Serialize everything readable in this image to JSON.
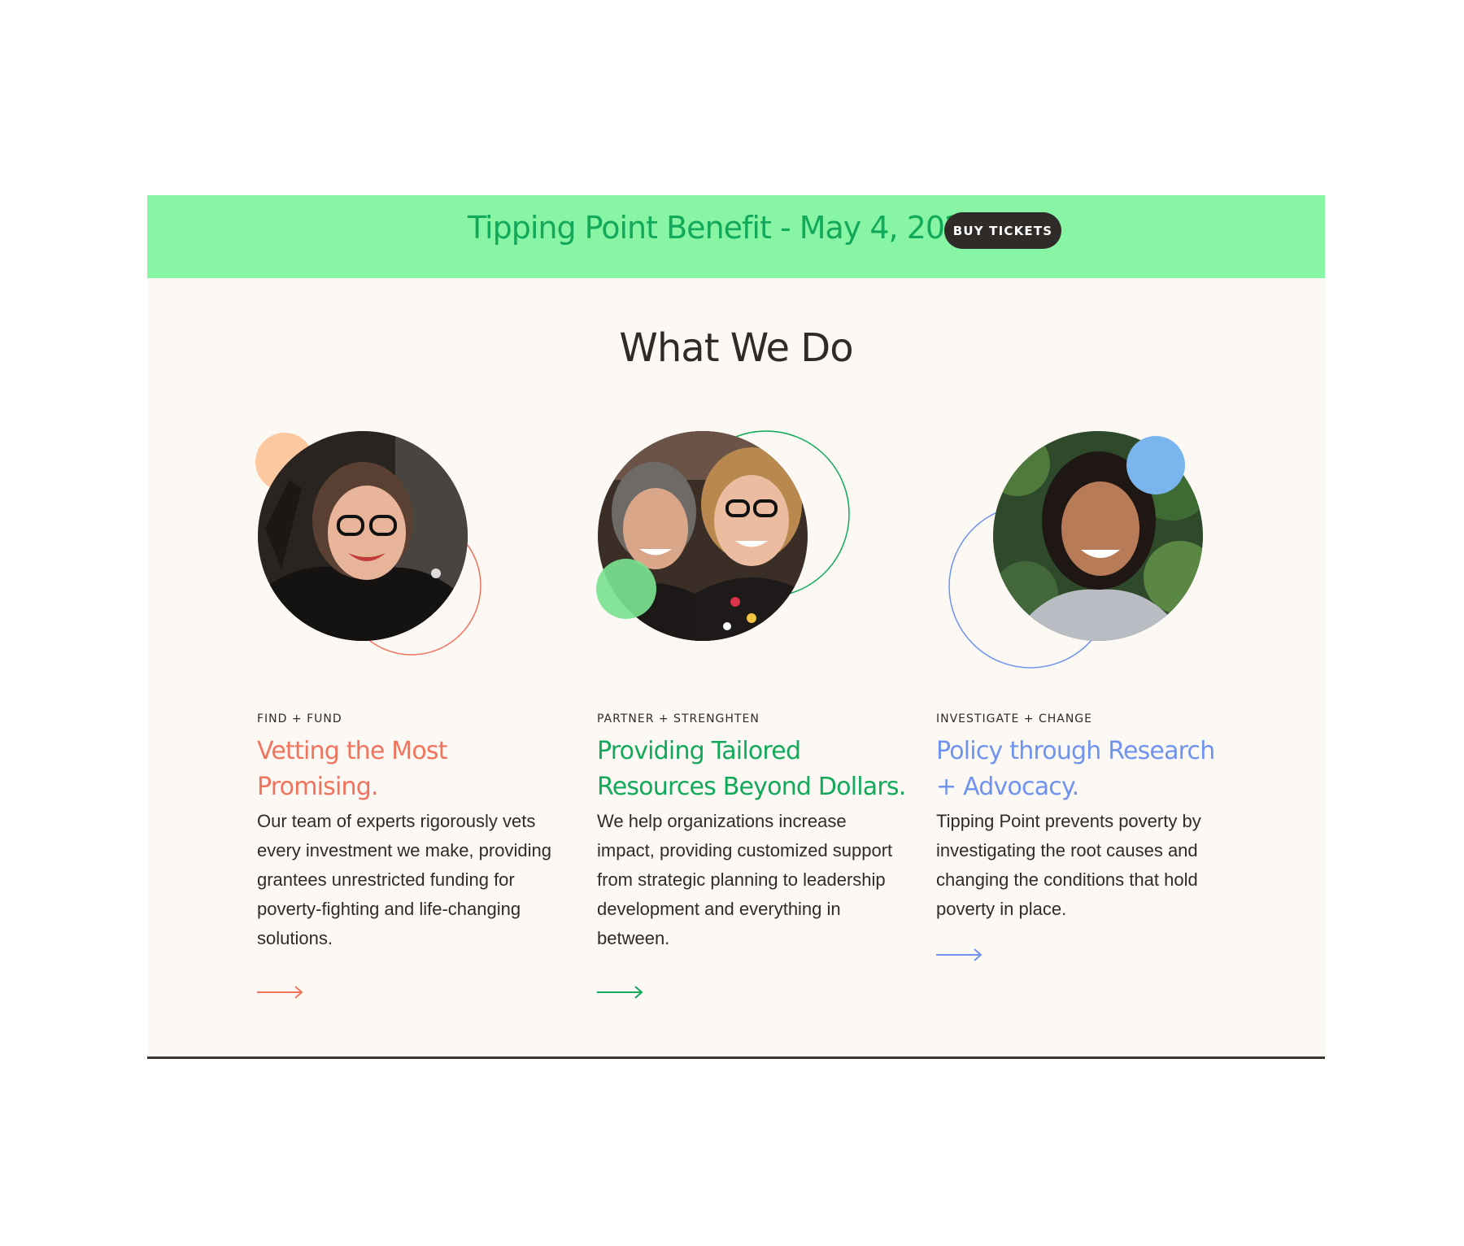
{
  "banner": {
    "text": "Tipping Point Benefit - May 4, 2023.",
    "button_label": "BUY TICKETS",
    "colors": {
      "background": "#88f5a5",
      "text": "#12a95a",
      "button": "#2f2b29"
    }
  },
  "section": {
    "title": "What We Do"
  },
  "cards": [
    {
      "eyebrow": "FIND + FUND",
      "title_line1": "Vetting the Most",
      "title_line2": "Promising.",
      "body": "Our team of experts rigorously vets every investment we make, providing grantees unrestricted funding for poverty-fighting and life-changing solutions.",
      "accent": "#f2735c",
      "arrow_icon": "arrow-right-icon"
    },
    {
      "eyebrow": "PARTNER + STRENGHTEN",
      "title_line1": "Providing Tailored",
      "title_line2": "Resources Beyond Dollars.",
      "body": "We help organizations increase impact, providing customized support from strategic planning to leadership development and everything in between.",
      "accent": "#12a95a",
      "arrow_icon": "arrow-right-icon"
    },
    {
      "eyebrow": "INVESTIGATE + CHANGE",
      "title_line1": "Policy through Research",
      "title_line2": "+ Advocacy.",
      "body": "Tipping Point prevents poverty by investigating the root causes and changing the conditions that hold poverty in place.",
      "accent": "#6f93ef",
      "arrow_icon": "arrow-right-icon"
    }
  ]
}
